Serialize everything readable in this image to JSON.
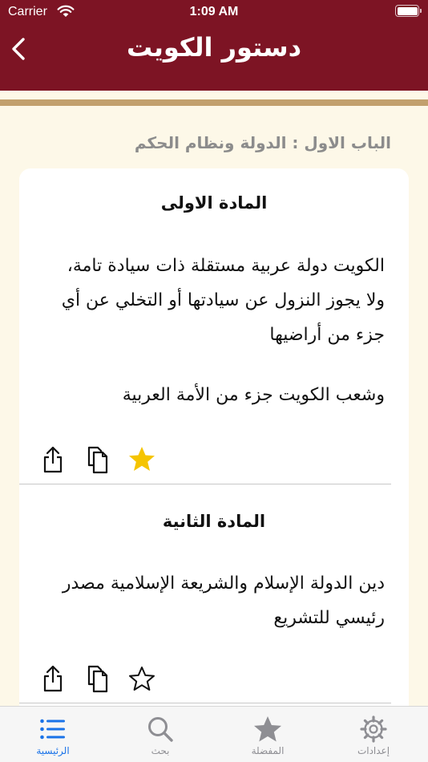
{
  "status_bar": {
    "carrier": "Carrier",
    "time": "1:09 AM"
  },
  "header": {
    "title": "دستور الكويت"
  },
  "breadcrumb": "الباب الاول : الدولة ونظام الحكم",
  "articles": [
    {
      "title": "المادة الاولى",
      "paragraphs": [
        "الكويت دولة عربية مستقلة ذات سيادة تامة، ولا يجوز النزول عن سيادتها أو التخلي عن أي جزء من أراضيها",
        "وشعب الكويت جزء من الأمة العربية"
      ],
      "favorited": true
    },
    {
      "title": "المادة الثانية",
      "paragraphs": [
        "دين الدولة الإسلام والشريعة الإسلامية مصدر رئيسي للتشريع"
      ],
      "favorited": false
    }
  ],
  "tabs": [
    {
      "label": "إعدادات",
      "icon": "gear-icon",
      "active": false
    },
    {
      "label": "المفضلة",
      "icon": "star-icon",
      "active": false
    },
    {
      "label": "بحث",
      "icon": "search-icon",
      "active": false
    },
    {
      "label": "الرئيسية",
      "icon": "list-icon",
      "active": true
    }
  ],
  "colors": {
    "header": "#7d1424",
    "gold_stripe": "#c2a06d",
    "background": "#fdf8e8",
    "favorite_star": "#f5c400",
    "active_tab": "#1a73e8",
    "inactive_tab": "#8e8e93"
  }
}
